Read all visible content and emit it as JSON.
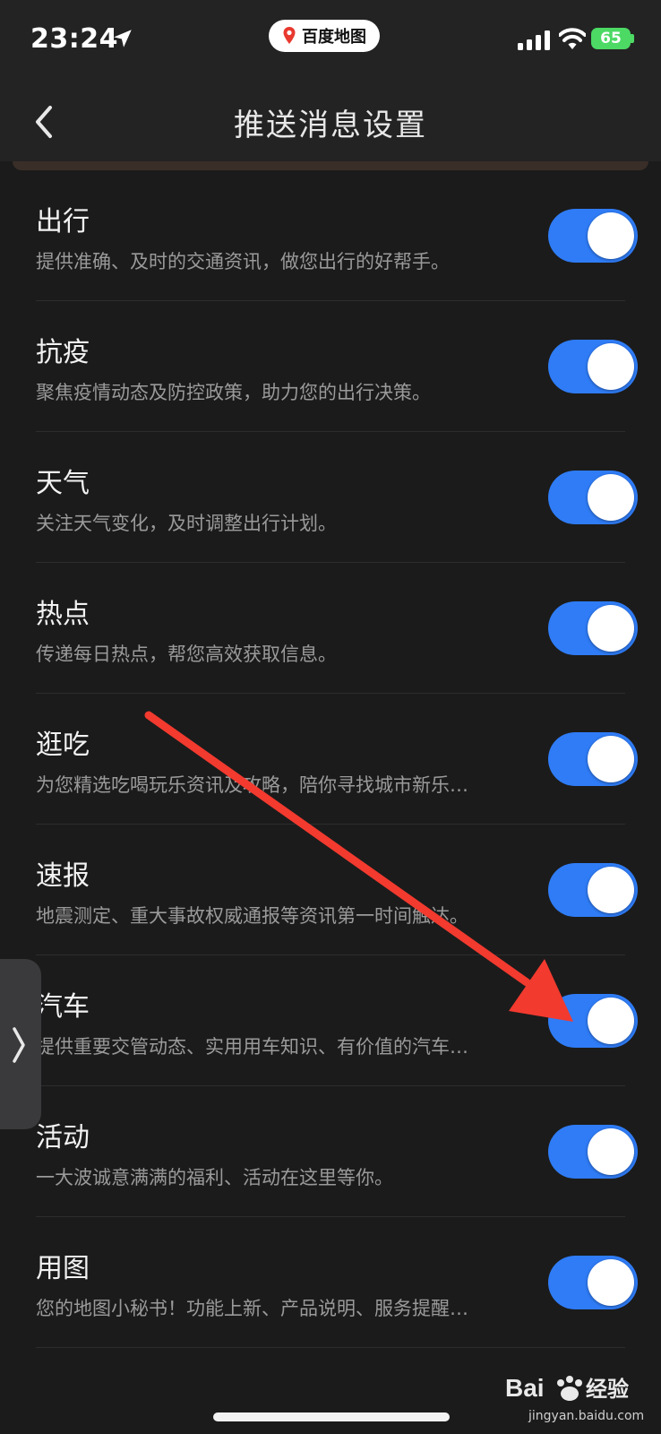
{
  "status_bar": {
    "time": "23:24",
    "app_badge": "百度地图",
    "battery": "65"
  },
  "nav": {
    "title": "推送消息设置"
  },
  "settings": [
    {
      "title": "出行",
      "desc": "提供准确、及时的交通资讯，做您出行的好帮手。",
      "enabled": true
    },
    {
      "title": "抗疫",
      "desc": "聚焦疫情动态及防控政策，助力您的出行决策。",
      "enabled": true
    },
    {
      "title": "天气",
      "desc": "关注天气变化，及时调整出行计划。",
      "enabled": true
    },
    {
      "title": "热点",
      "desc": "传递每日热点，帮您高效获取信息。",
      "enabled": true
    },
    {
      "title": "逛吃",
      "desc": "为您精选吃喝玩乐资讯及攻略，陪你寻找城市新乐…",
      "enabled": true
    },
    {
      "title": "速报",
      "desc": "地震测定、重大事故权威通报等资讯第一时间触达。",
      "enabled": true
    },
    {
      "title": "汽车",
      "desc": "提供重要交管动态、实用用车知识、有价值的汽车…",
      "enabled": true
    },
    {
      "title": "活动",
      "desc": "一大波诚意满满的福利、活动在这里等你。",
      "enabled": true
    },
    {
      "title": "用图",
      "desc": "您的地图小秘书！功能上新、产品说明、服务提醒…",
      "enabled": true
    }
  ],
  "watermark": {
    "brand": "Bai经验",
    "url": "jingyan.baidu.com"
  },
  "colors": {
    "background": "#1b1b1b",
    "toggle_on": "#2f7cf6",
    "annotation_arrow": "#f23a2f"
  }
}
